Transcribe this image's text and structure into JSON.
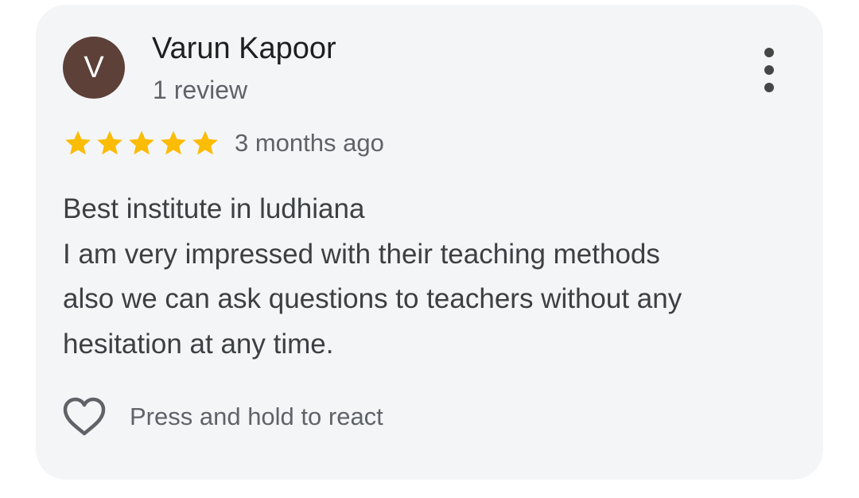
{
  "review": {
    "author": {
      "initial": "V",
      "name": "Varun Kapoor",
      "review_count": "1 review",
      "avatar_color": "#5d4037"
    },
    "rating": 5,
    "rating_max": 5,
    "date": "3 months ago",
    "text_lines": [
      "Best institute in ludhiana",
      "I am very impressed with their teaching methods",
      "also we can ask questions to teachers without any",
      "hesitation at any time."
    ],
    "react_label": "Press and hold to react",
    "icons": {
      "more": "more-vert-icon",
      "star": "star-icon",
      "heart": "heart-outline-icon"
    },
    "colors": {
      "card_background": "#f4f5f7",
      "star": "#fbbc04",
      "text_primary": "#1f1f1f",
      "text_secondary": "#5f6368"
    }
  }
}
